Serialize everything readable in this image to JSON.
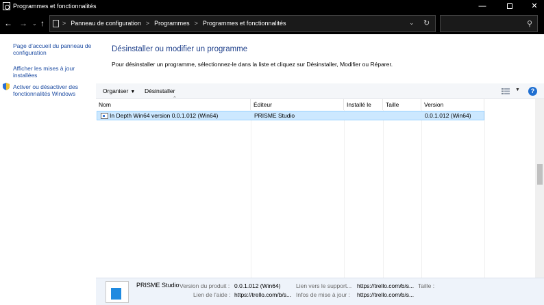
{
  "window": {
    "title": "Programmes et fonctionnalités"
  },
  "address": {
    "crumbs": [
      "Panneau de configuration",
      "Programmes",
      "Programmes et fonctionnalités"
    ],
    "separator": ">"
  },
  "search": {
    "placeholder": ""
  },
  "sidebar": {
    "links": [
      "Page d’accueil du panneau de configuration",
      "Afficher les mises à jour installées",
      "Activer ou désactiver des fonctionnalités Windows"
    ]
  },
  "main": {
    "heading": "Désinstaller ou modifier un programme",
    "description": "Pour désinstaller un programme, sélectionnez-le dans la liste et cliquez sur Désinstaller, Modifier ou Réparer."
  },
  "toolbar": {
    "organize": "Organiser",
    "uninstall": "Désinstaller"
  },
  "columns": [
    "Nom",
    "Éditeur",
    "Installé le",
    "Taille",
    "Version"
  ],
  "programs": [
    {
      "name": "In Depth Win64 version 0.0.1.012 (Win64)",
      "publisher": "PRISME Studio",
      "installed": "",
      "size": "",
      "version": "0.0.1.012 (Win64)"
    }
  ],
  "details": {
    "publisher": "PRISME Studio",
    "product_version_label": "Version du produit :",
    "product_version": "0.0.1.012 (Win64)",
    "support_link_label": "Lien vers le support...",
    "support_link": "https://trello.com/b/s...",
    "size_label": "Taille :",
    "help_link_label": "Lien de l'aide :",
    "help_link": "https://trello.com/b/s...",
    "update_info_label": "Infos de mise à jour :",
    "update_info": "https://trello.com/b/s..."
  },
  "colors": {
    "titlebar": "#000000",
    "link": "#1d4ca2",
    "heading": "#1e3f8a",
    "selected_row": "#cce8ff",
    "details_bg": "#eef3fa"
  }
}
